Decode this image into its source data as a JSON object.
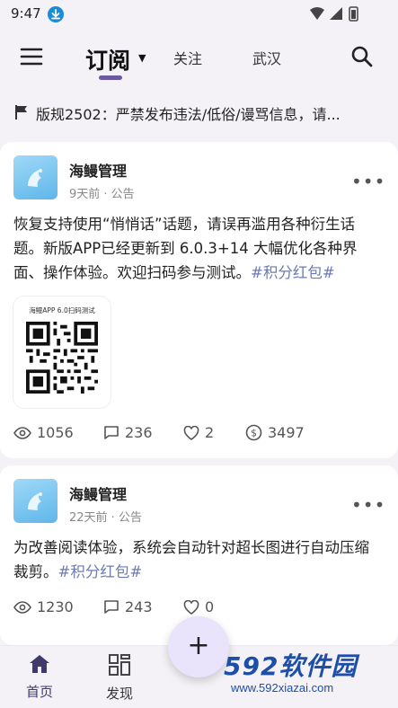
{
  "status_bar": {
    "time": "9:47"
  },
  "header": {
    "active_tab": "订阅",
    "tabs": [
      "关注",
      "武汉"
    ]
  },
  "notice": {
    "text": "版规2502：严禁发布违法/低俗/谩骂信息，请..."
  },
  "posts": [
    {
      "author": "海鳗管理",
      "meta": "9天前 · 公告",
      "body": "恢复支持使用“悄悄话”话题，请误再滥用各种衍生话题。新版APP已经更新到 6.0.3+14 大幅优化各种界面、操作体验。欢迎扫码参与测试。",
      "hashtag": "#积分红包#",
      "image_caption": "海鳗APP 6.0扫码测试",
      "views": "1056",
      "comments": "236",
      "likes": "2",
      "coins": "3497"
    },
    {
      "author": "海鳗管理",
      "meta": "22天前 · 公告",
      "body": "为改善阅读体验，系统会自动针对超长图进行自动压缩裁剪。",
      "hashtag": "#积分红包#",
      "views": "1230",
      "comments": "243",
      "likes": "0"
    }
  ],
  "bottom_nav": {
    "items": [
      {
        "label": "首页",
        "icon": "home-icon"
      },
      {
        "label": "发现",
        "icon": "grid-icon"
      }
    ],
    "fab_symbol": "+"
  },
  "watermark": {
    "brand": "592软件园",
    "url": "www.592xiazai.com"
  },
  "colors": {
    "accent": "#6b5aa3",
    "hashtag": "#6c7ab3",
    "background": "#f4f2f7"
  }
}
